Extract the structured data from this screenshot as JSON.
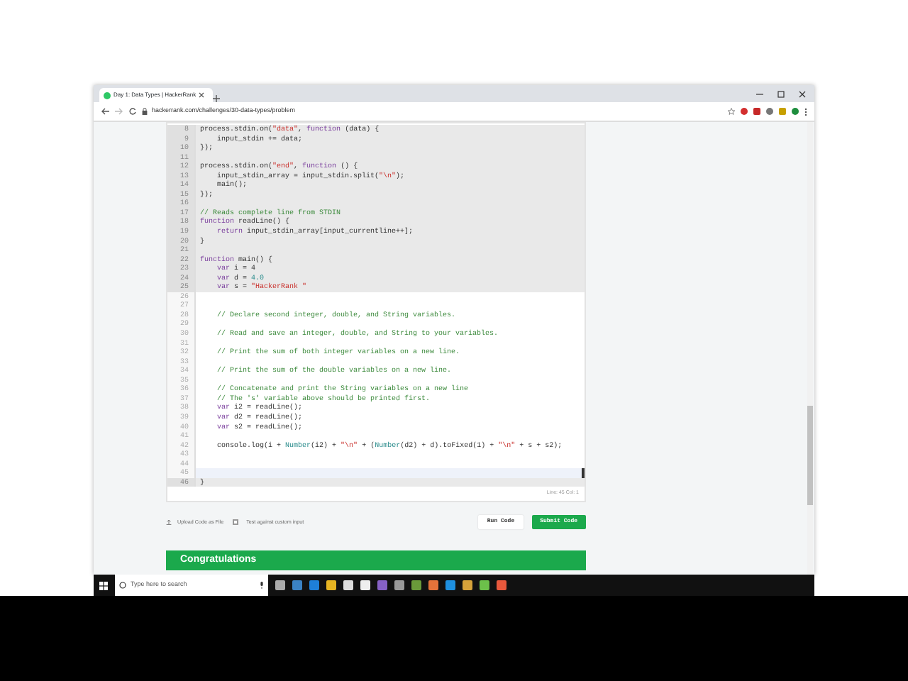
{
  "browser": {
    "tab_title": "Day 1: Data Types | HackerRank",
    "url": "hackerrank.com/challenges/30-data-types/problem"
  },
  "editor": {
    "lines": [
      {
        "number": "8",
        "readonly": true,
        "active": false,
        "parts": [
          {
            "kind": "plain",
            "text": "process.stdin.on("
          },
          {
            "kind": "string",
            "text": "\"data\""
          },
          {
            "kind": "plain",
            "text": ", "
          },
          {
            "kind": "keyword",
            "text": "function"
          },
          {
            "kind": "plain",
            "text": " (data) {"
          }
        ]
      },
      {
        "number": "9",
        "readonly": true,
        "active": false,
        "parts": [
          {
            "kind": "plain",
            "text": "    input_stdin += data;"
          }
        ]
      },
      {
        "number": "10",
        "readonly": true,
        "active": false,
        "parts": [
          {
            "kind": "plain",
            "text": "});"
          }
        ]
      },
      {
        "number": "11",
        "readonly": true,
        "active": false
      },
      {
        "number": "12",
        "readonly": true,
        "active": false,
        "parts": [
          {
            "kind": "plain",
            "text": "process.stdin.on("
          },
          {
            "kind": "string",
            "text": "\"end\""
          },
          {
            "kind": "plain",
            "text": ", "
          },
          {
            "kind": "keyword",
            "text": "function"
          },
          {
            "kind": "plain",
            "text": " () {"
          }
        ]
      },
      {
        "number": "13",
        "readonly": true,
        "active": false,
        "parts": [
          {
            "kind": "plain",
            "text": "    input_stdin_array = input_stdin.split("
          },
          {
            "kind": "string",
            "text": "\"\\n\""
          },
          {
            "kind": "plain",
            "text": ");"
          }
        ]
      },
      {
        "number": "14",
        "readonly": true,
        "active": false,
        "parts": [
          {
            "kind": "plain",
            "text": "    main();"
          }
        ]
      },
      {
        "number": "15",
        "readonly": true,
        "active": false,
        "parts": [
          {
            "kind": "plain",
            "text": "});"
          }
        ]
      },
      {
        "number": "16",
        "readonly": true,
        "active": false
      },
      {
        "number": "17",
        "readonly": true,
        "active": false,
        "parts": [
          {
            "kind": "comment",
            "text": "// Reads complete line from STDIN"
          }
        ]
      },
      {
        "number": "18",
        "readonly": true,
        "active": false,
        "parts": [
          {
            "kind": "keyword",
            "text": "function"
          },
          {
            "kind": "plain",
            "text": " readLine() {"
          }
        ]
      },
      {
        "number": "19",
        "readonly": true,
        "active": false,
        "parts": [
          {
            "kind": "keyword",
            "text": "    return"
          },
          {
            "kind": "plain",
            "text": " input_stdin_array[input_currentline++];"
          }
        ]
      },
      {
        "number": "20",
        "readonly": true,
        "active": false,
        "parts": [
          {
            "kind": "plain",
            "text": "}"
          }
        ]
      },
      {
        "number": "21",
        "readonly": true,
        "active": false
      },
      {
        "number": "22",
        "readonly": true,
        "active": false,
        "parts": [
          {
            "kind": "keyword",
            "text": "function"
          },
          {
            "kind": "plain",
            "text": " main() {"
          }
        ]
      },
      {
        "number": "23",
        "readonly": true,
        "active": false,
        "parts": [
          {
            "kind": "keyword",
            "text": "    var"
          },
          {
            "kind": "plain",
            "text": " i = 4"
          }
        ]
      },
      {
        "number": "24",
        "readonly": true,
        "active": false,
        "parts": [
          {
            "kind": "keyword",
            "text": "    var"
          },
          {
            "kind": "plain",
            "text": " d = "
          },
          {
            "kind": "number",
            "text": "4.0"
          }
        ]
      },
      {
        "number": "25",
        "readonly": true,
        "active": false,
        "parts": [
          {
            "kind": "keyword",
            "text": "    var"
          },
          {
            "kind": "plain",
            "text": " s = "
          },
          {
            "kind": "string",
            "text": "\"HackerRank \""
          }
        ]
      },
      {
        "number": "26",
        "readonly": false,
        "active": false
      },
      {
        "number": "27",
        "readonly": false,
        "active": false
      },
      {
        "number": "28",
        "readonly": false,
        "active": false,
        "parts": [
          {
            "kind": "comment",
            "text": "    // Declare second integer, double, and String variables."
          }
        ]
      },
      {
        "number": "29",
        "readonly": false,
        "active": false
      },
      {
        "number": "30",
        "readonly": false,
        "active": false,
        "parts": [
          {
            "kind": "comment",
            "text": "    // Read and save an integer, double, and String to your variables."
          }
        ]
      },
      {
        "number": "31",
        "readonly": false,
        "active": false
      },
      {
        "number": "32",
        "readonly": false,
        "active": false,
        "parts": [
          {
            "kind": "comment",
            "text": "    // Print the sum of both integer variables on a new line."
          }
        ]
      },
      {
        "number": "33",
        "readonly": false,
        "active": false
      },
      {
        "number": "34",
        "readonly": false,
        "active": false,
        "parts": [
          {
            "kind": "comment",
            "text": "    // Print the sum of the double variables on a new line."
          }
        ]
      },
      {
        "number": "35",
        "readonly": false,
        "active": false
      },
      {
        "number": "36",
        "readonly": false,
        "active": false,
        "parts": [
          {
            "kind": "comment",
            "text": "    // Concatenate and print the String variables on a new line"
          }
        ]
      },
      {
        "number": "37",
        "readonly": false,
        "active": false,
        "parts": [
          {
            "kind": "comment",
            "text": "    // The 's' variable above should be printed first."
          }
        ]
      },
      {
        "number": "38",
        "readonly": false,
        "active": false,
        "parts": [
          {
            "kind": "keyword",
            "text": "    var"
          },
          {
            "kind": "plain",
            "text": " i2 = readLine();"
          }
        ]
      },
      {
        "number": "39",
        "readonly": false,
        "active": false,
        "parts": [
          {
            "kind": "keyword",
            "text": "    var"
          },
          {
            "kind": "plain",
            "text": " d2 = readLine();"
          }
        ]
      },
      {
        "number": "40",
        "readonly": false,
        "active": false,
        "parts": [
          {
            "kind": "keyword",
            "text": "    var"
          },
          {
            "kind": "plain",
            "text": " s2 = readLine();"
          }
        ]
      },
      {
        "number": "41",
        "readonly": false,
        "active": false
      },
      {
        "number": "42",
        "readonly": false,
        "active": false,
        "parts": [
          {
            "kind": "plain",
            "text": "    console.log(i + "
          },
          {
            "kind": "number",
            "text": "Number"
          },
          {
            "kind": "plain",
            "text": "(i2) + "
          },
          {
            "kind": "string",
            "text": "\"\\n\""
          },
          {
            "kind": "plain",
            "text": " + ("
          },
          {
            "kind": "number",
            "text": "Number"
          },
          {
            "kind": "plain",
            "text": "(d2) + d).toFixed(1) + "
          },
          {
            "kind": "string",
            "text": "\"\\n\""
          },
          {
            "kind": "plain",
            "text": " + s + s2);"
          }
        ]
      },
      {
        "number": "43",
        "readonly": false,
        "active": false
      },
      {
        "number": "44",
        "readonly": false,
        "active": false
      },
      {
        "number": "45",
        "readonly": false,
        "active": true
      },
      {
        "number": "46",
        "readonly": true,
        "active": false,
        "parts": [
          {
            "kind": "plain",
            "text": "}"
          }
        ]
      }
    ],
    "status": "Line: 45 Col: 1"
  },
  "actions": {
    "upload_label": "Upload Code as File",
    "custom_input": {
      "label": "Test against custom input",
      "checked": false
    },
    "buttons": [
      {
        "label": "Run Code",
        "kind": "secondary"
      },
      {
        "label": "Submit Code",
        "kind": "primary"
      }
    ]
  },
  "banner": {
    "title": "Congratulations"
  },
  "taskbar": {
    "search_placeholder": "Type here to search"
  }
}
